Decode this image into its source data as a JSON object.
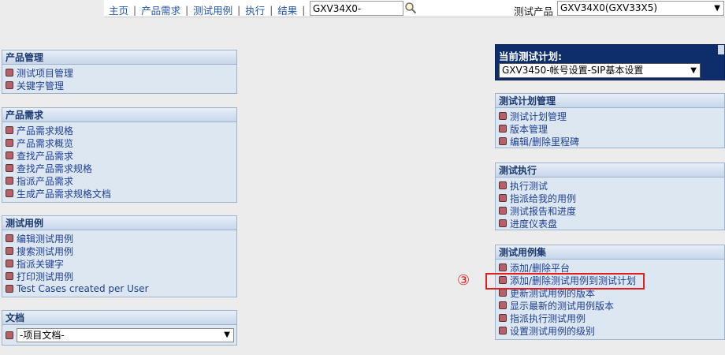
{
  "nav": {
    "home": "主页",
    "requirements": "产品需求",
    "test_cases": "测试用例",
    "execute": "执行",
    "results": "结果",
    "separator": "|",
    "search_value": "GXV34X0-",
    "product_label": "测试产品",
    "product_value": "GXV34X0(GXV33X5)"
  },
  "left_panels": {
    "product_mgmt": {
      "title": "产品管理",
      "items": [
        "测试项目管理",
        "关键字管理"
      ]
    },
    "requirements": {
      "title": "产品需求",
      "items": [
        "产品需求规格",
        "产品需求概览",
        "查找产品需求",
        "查找产品需求规格",
        "指派产品需求",
        "生成产品需求规格文档"
      ]
    },
    "test_cases": {
      "title": "测试用例",
      "items": [
        "编辑测试用例",
        "搜索测试用例",
        "指派关键字",
        "打印测试用例",
        "Test Cases created per User"
      ]
    },
    "documents": {
      "title": "文档",
      "select_value": "-项目文档-"
    }
  },
  "current_plan": {
    "title": "当前测试计划:",
    "value": "GXV3450-帐号设置-SIP基本设置"
  },
  "right_panels": {
    "plan_mgmt": {
      "title": "测试计划管理",
      "items": [
        "测试计划管理",
        "版本管理",
        "编辑/删除里程碑"
      ]
    },
    "execution": {
      "title": "测试执行",
      "items": [
        "执行测试",
        "指派给我的用例",
        "测试报告和进度",
        "进度仪表盘"
      ]
    },
    "case_set": {
      "title": "测试用例集",
      "items": [
        "添加/删除平台",
        "添加/删除测试用例到测试计划",
        "更新测试用例的版本",
        "显示最新的测试用例版本",
        "指派执行测试用例",
        "设置测试用例的级别"
      ]
    }
  },
  "annotation": {
    "step": "③"
  },
  "colors": {
    "plan_box_bg": "#0d2d6b",
    "highlight": "#e02020",
    "panel_bg": "#dce7f2",
    "link": "#1f3f93"
  }
}
